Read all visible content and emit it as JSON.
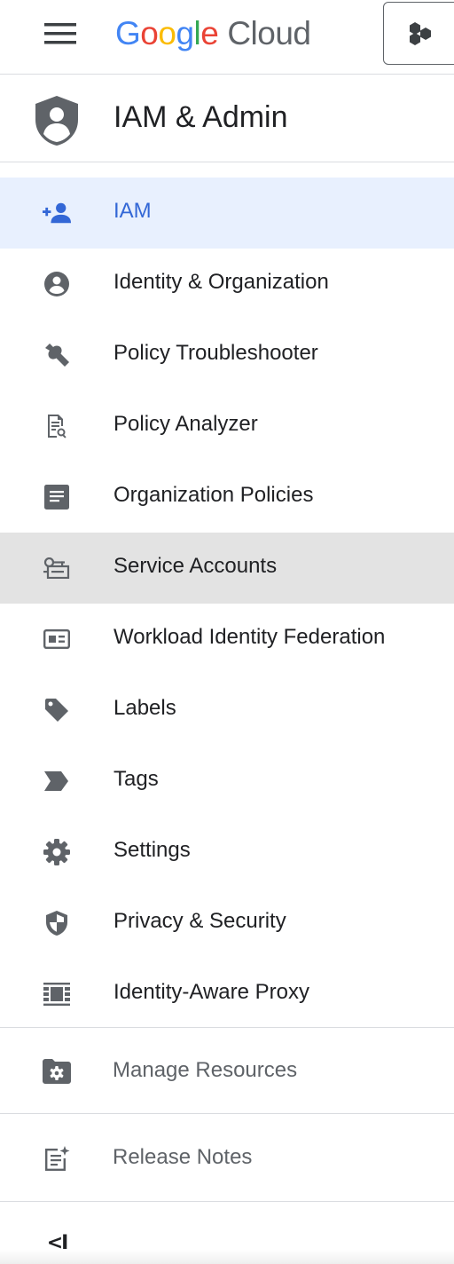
{
  "header": {
    "logo_google": [
      "G",
      "o",
      "o",
      "g",
      "l",
      "e"
    ],
    "logo_cloud": "Cloud",
    "menu_icon": "hamburger-menu-icon",
    "project_icon": "project-hexagons-icon"
  },
  "section": {
    "title": "IAM & Admin",
    "icon": "iam-shield-icon"
  },
  "nav": {
    "items": [
      {
        "label": "IAM",
        "icon": "person-add-icon",
        "state": "selected"
      },
      {
        "label": "Identity & Organization",
        "icon": "account-circle-icon"
      },
      {
        "label": "Policy Troubleshooter",
        "icon": "wrench-icon"
      },
      {
        "label": "Policy Analyzer",
        "icon": "document-search-icon"
      },
      {
        "label": "Organization Policies",
        "icon": "article-icon"
      },
      {
        "label": "Service Accounts",
        "icon": "service-account-key-icon",
        "state": "hovered"
      },
      {
        "label": "Workload Identity Federation",
        "icon": "id-card-icon"
      },
      {
        "label": "Labels",
        "icon": "label-tag-icon"
      },
      {
        "label": "Tags",
        "icon": "tag-chevron-icon"
      },
      {
        "label": "Settings",
        "icon": "gear-icon"
      },
      {
        "label": "Privacy & Security",
        "icon": "security-shield-icon"
      },
      {
        "label": "Identity-Aware Proxy",
        "icon": "proxy-icon"
      }
    ]
  },
  "footer_links": {
    "manage_resources": "Manage Resources",
    "release_notes": "Release Notes",
    "collapse_label": "<I"
  },
  "colors": {
    "active_bg": "#e8f0fe",
    "active_text": "#3367d6",
    "hover_bg": "#e3e3e3",
    "icon_gray": "#5f6368"
  }
}
